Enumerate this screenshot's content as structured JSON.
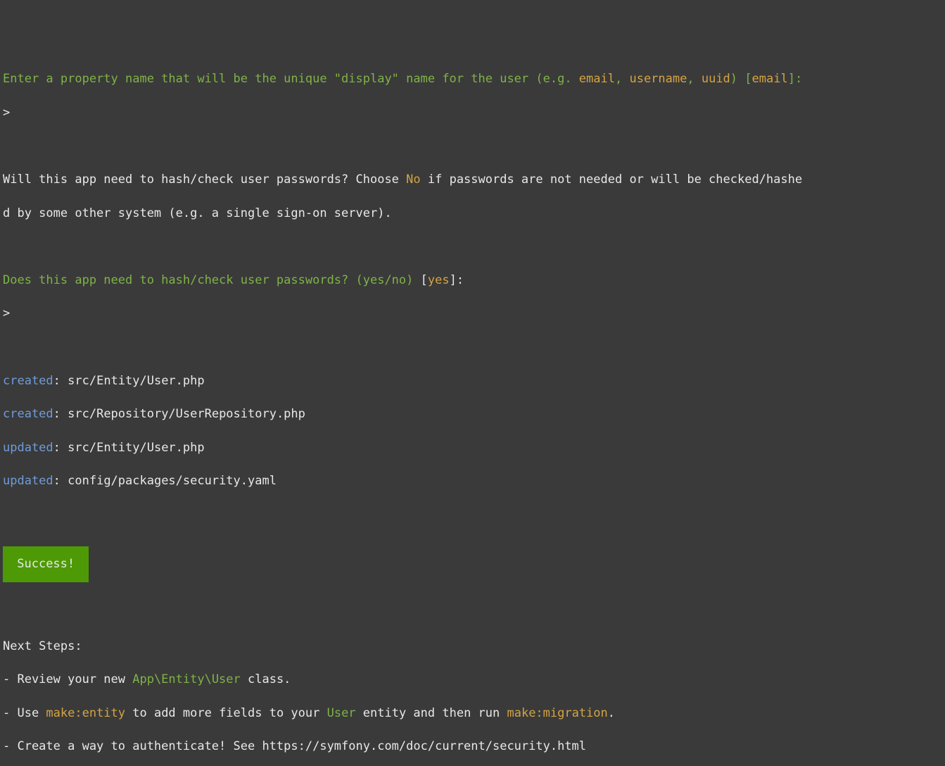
{
  "prompt1": {
    "prefix": "Enter a property name that will be the unique \"display\" name for the user (e.g. ",
    "example1": "email",
    "sep1": ", ",
    "example2": "username",
    "sep2": ", ",
    "example3": "uuid",
    "suffix1": ") [",
    "default": "email",
    "suffix2": "]:"
  },
  "input1": ">",
  "hash_question": {
    "prefix": " Will this app need to hash/check user passwords? Choose ",
    "no_word": "No",
    "suffix": " if passwords are not needed or will be checked/hashe",
    "line2": "d by some other system (e.g. a single sign-on server)."
  },
  "prompt2": {
    "question": " Does this app need to hash/check user passwords? (yes/no)",
    "bracket_open": " [",
    "default": "yes",
    "bracket_close": "]:"
  },
  "input2": " >",
  "files": [
    {
      "action": "created",
      "path": "src/Entity/User.php"
    },
    {
      "action": "created",
      "path": "src/Repository/UserRepository.php"
    },
    {
      "action": "updated",
      "path": "src/Entity/User.php"
    },
    {
      "action": "updated",
      "path": "config/packages/security.yaml"
    }
  ],
  "success_label": " Success! ",
  "next_steps": {
    "header": "  Next Steps:",
    "step1": {
      "prefix": "   - Review your new ",
      "class": "App\\Entity\\User",
      "suffix": " class."
    },
    "step2": {
      "prefix": "   - Use ",
      "cmd1": "make:entity",
      "mid": " to add more fields to your ",
      "entity": "User",
      "mid2": " entity and then run ",
      "cmd2": "make:migration",
      "suffix": "."
    },
    "step3": "   - Create a way to authenticate! See https://symfony.com/doc/current/security.html"
  }
}
